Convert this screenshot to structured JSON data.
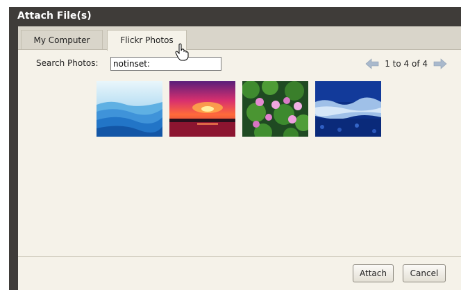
{
  "dialog": {
    "title": "Attach File(s)"
  },
  "tabs": [
    {
      "label": "My Computer",
      "active": false
    },
    {
      "label": "Flickr Photos",
      "active": true
    }
  ],
  "search": {
    "label": "Search Photos:",
    "value": "notinset:"
  },
  "pager": {
    "text": "1 to 4 of 4",
    "prev_icon": "left-arrow-icon",
    "next_icon": "right-arrow-icon"
  },
  "thumbnails": [
    {
      "name": "blue-mountains"
    },
    {
      "name": "sunset-sea"
    },
    {
      "name": "water-lilies"
    },
    {
      "name": "blue-foliage"
    }
  ],
  "buttons": {
    "attach_label": "Attach",
    "cancel_label": "Cancel"
  },
  "colors": {
    "title_bar": "#3f3c39",
    "panel_bg": "#f5f2e9",
    "tab_bar": "#d9d5ca",
    "arrow": "#a9b9cc"
  }
}
